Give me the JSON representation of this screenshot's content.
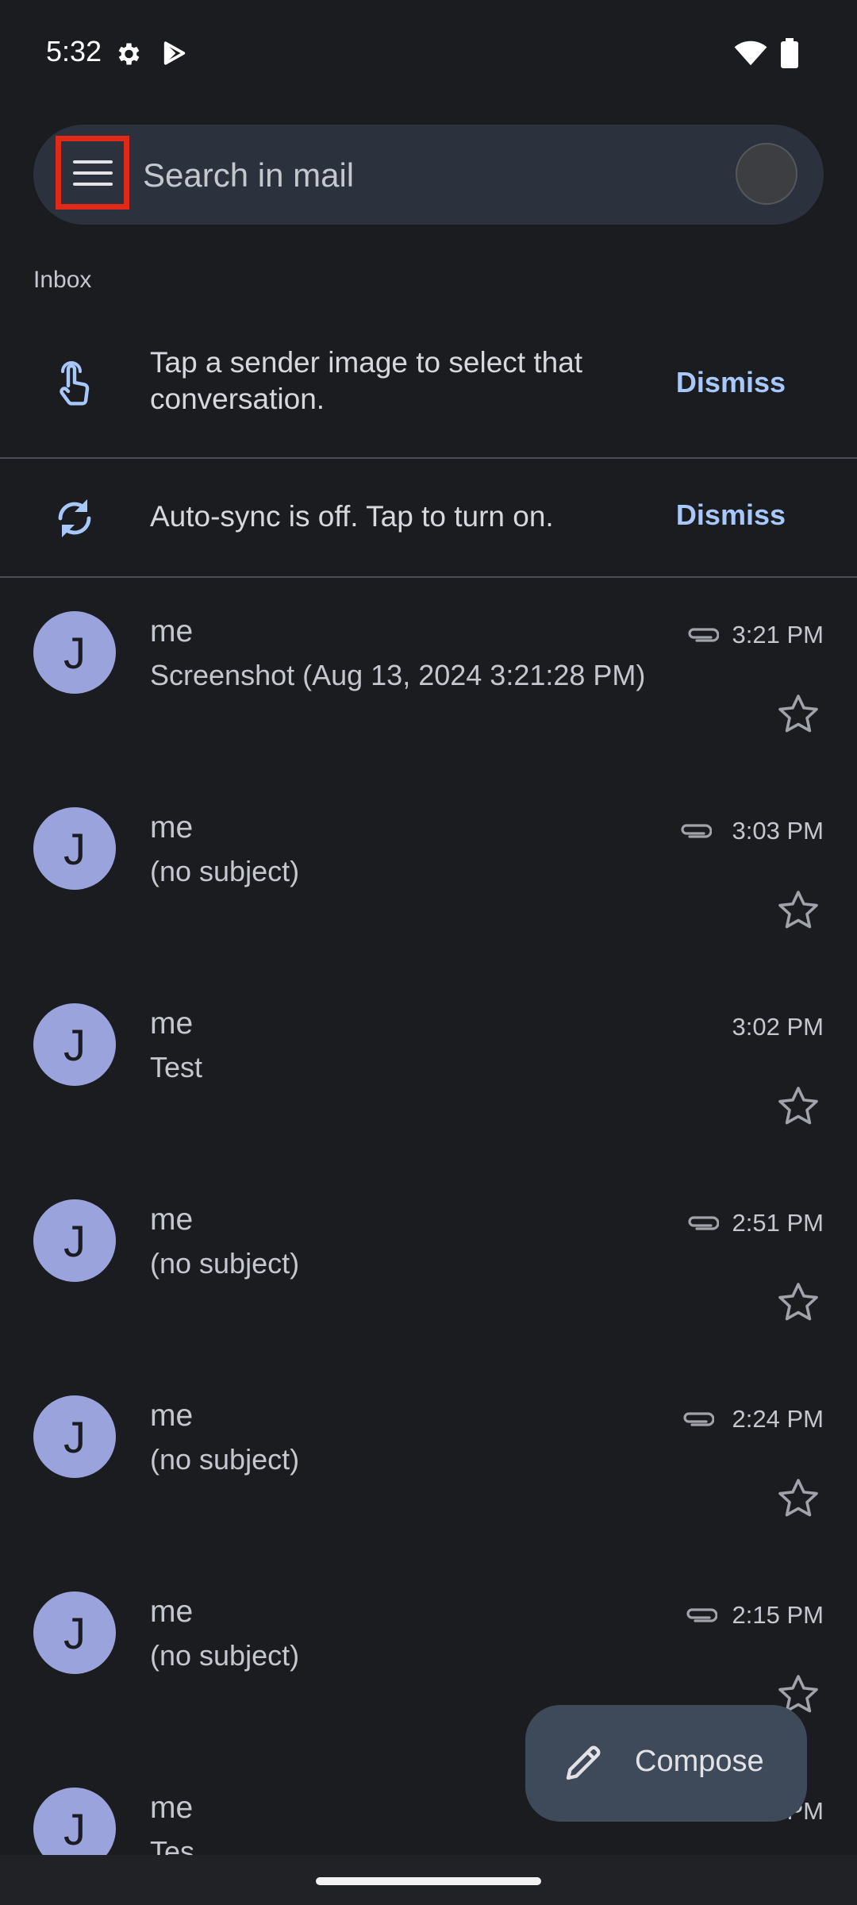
{
  "status_bar": {
    "time": "5:32",
    "icons": [
      "gear-icon",
      "play-store-icon",
      "wifi-icon",
      "battery-icon"
    ]
  },
  "search": {
    "placeholder": "Search in mail",
    "menu_icon": "hamburger-menu-icon"
  },
  "inbox_label": "Inbox",
  "banners": [
    {
      "icon": "tap-hand-icon",
      "text": "Tap a sender image to select that conversation.",
      "dismiss": "Dismiss"
    },
    {
      "icon": "sync-icon",
      "text": "Auto-sync is off. Tap to turn on.",
      "dismiss": "Dismiss"
    }
  ],
  "emails": [
    {
      "initial": "J",
      "sender": "me",
      "subject": "Screenshot (Aug 13, 2024 3:21:28 PM)",
      "time": "3:21 PM",
      "attachment": true,
      "starred": false
    },
    {
      "initial": "J",
      "sender": "me",
      "subject": "(no subject)",
      "time": "3:03 PM",
      "attachment": true,
      "starred": false
    },
    {
      "initial": "J",
      "sender": "me",
      "subject": "Test",
      "time": "3:02 PM",
      "attachment": false,
      "starred": false
    },
    {
      "initial": "J",
      "sender": "me",
      "subject": "(no subject)",
      "time": "2:51 PM",
      "attachment": true,
      "starred": false
    },
    {
      "initial": "J",
      "sender": "me",
      "subject": "(no subject)",
      "time": "2:24 PM",
      "attachment": true,
      "starred": false
    },
    {
      "initial": "J",
      "sender": "me",
      "subject": "(no subject)",
      "time": "2:15 PM",
      "attachment": true,
      "starred": false
    },
    {
      "initial": "J",
      "sender": "me",
      "subject": "Tes",
      "time": "PM",
      "attachment": false,
      "starred": false
    }
  ],
  "compose": {
    "label": "Compose",
    "icon": "pencil-icon"
  },
  "colors": {
    "background": "#1b1c20",
    "search_bar": "#2b323d",
    "avatar": "#9aa3dc",
    "dismiss": "#a8c7fa",
    "highlight_box": "#e02a17",
    "compose_fab": "#3e4a5a"
  }
}
